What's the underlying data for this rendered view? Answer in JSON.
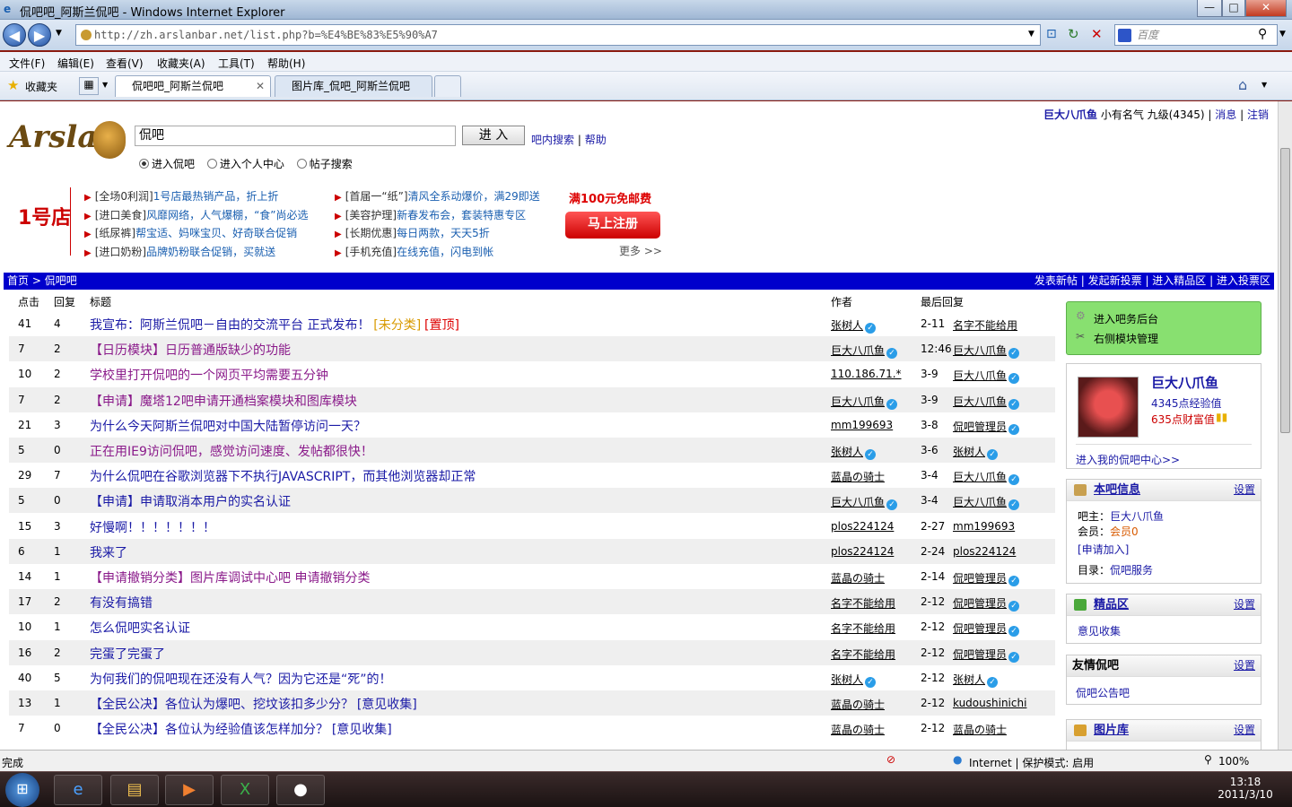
{
  "window": {
    "title": "侃吧吧_阿斯兰侃吧 - Windows Internet Explorer",
    "min": "—",
    "max": "□",
    "close": "✕"
  },
  "browser": {
    "url": "http://zh.arslanbar.net/list.php?b=%E4%BE%83%E5%90%A7",
    "search_placeholder": "百度",
    "menu": [
      "文件(F)",
      "编辑(E)",
      "查看(V)",
      "收藏夹(A)",
      "工具(T)",
      "帮助(H)"
    ],
    "favorites": "收藏夹",
    "tabs": [
      "侃吧吧_阿斯兰侃吧",
      "图片库_侃吧_阿斯兰侃吧"
    ]
  },
  "user": {
    "name": "巨大八爪鱼",
    "rank": "小有名气 九级(4345)",
    "msg": "消息",
    "logout": "注销",
    "sep": "|"
  },
  "site": {
    "logo": "Arslan"
  },
  "search": {
    "value": "侃吧",
    "button": "进 入",
    "inbar": "吧内搜索",
    "help": "帮助",
    "sep": "|",
    "options": [
      "进入侃吧",
      "进入个人中心",
      "帖子搜索"
    ]
  },
  "ad": {
    "brand": "1号店",
    "left": [
      [
        "[全场0利润]",
        "1号店最热销产品，折上折"
      ],
      [
        "[进口美食]",
        "风靡网络，人气爆棚，“食”尚必选"
      ],
      [
        "[纸尿裤]",
        "帮宝适、妈咪宝贝、好奇联合促销"
      ],
      [
        "[进口奶粉]",
        "品牌奶粉联合促销，买就送"
      ]
    ],
    "right": [
      [
        "[首届一“纸”]",
        "清风全系动爆价，满29即送"
      ],
      [
        "[美容护理]",
        "新春发布会，套装特惠专区"
      ],
      [
        "[长期优惠]",
        "每日两款，天天5折"
      ],
      [
        "[手机充值]",
        "在线充值，闪电到帐"
      ]
    ],
    "promo": "满100元免邮费",
    "register": "马上注册",
    "more": "更多 >>"
  },
  "nav": {
    "home": "首页",
    "sep": ">",
    "current": "侃吧吧",
    "links": [
      "发表新帖",
      "发起新投票",
      "进入精品区",
      "进入投票区"
    ]
  },
  "table": {
    "headers": [
      "点击",
      "回复",
      "标题",
      "作者",
      "最后回复"
    ],
    "rows": [
      {
        "c": "41",
        "r": "4",
        "t": "我宣布：阿斯兰侃吧－自由的交流平台 正式发布！",
        "tags": [
          "[未分类]",
          "[置顶]"
        ],
        "a": "张树人",
        "av": true,
        "d": "2-11",
        "l": "名字不能给用",
        "lv": false,
        "pk": false
      },
      {
        "c": "7",
        "r": "2",
        "t": "【日历模块】日历普通版缺少的功能",
        "tags": [],
        "a": "巨大八爪鱼",
        "av": true,
        "d": "12:46",
        "l": "巨大八爪鱼",
        "lv": true,
        "pk": true
      },
      {
        "c": "10",
        "r": "2",
        "t": "学校里打开侃吧的一个网页平均需要五分钟",
        "tags": [],
        "a": "110.186.71.*",
        "av": false,
        "d": "3-9",
        "l": "巨大八爪鱼",
        "lv": true,
        "pk": true
      },
      {
        "c": "7",
        "r": "2",
        "t": "【申请】魔塔12吧申请开通档案模块和图库模块",
        "tags": [],
        "a": "巨大八爪鱼",
        "av": true,
        "d": "3-9",
        "l": "巨大八爪鱼",
        "lv": true,
        "pk": true
      },
      {
        "c": "21",
        "r": "3",
        "t": "为什么今天阿斯兰侃吧对中国大陆暂停访问一天？",
        "tags": [],
        "a": "mm199693",
        "av": false,
        "d": "3-8",
        "l": "侃吧管理员",
        "lv": true,
        "pk": false
      },
      {
        "c": "5",
        "r": "0",
        "t": "正在用IE9访问侃吧，感觉访问速度、发帖都很快！",
        "tags": [],
        "a": "张树人",
        "av": true,
        "d": "3-6",
        "l": "张树人",
        "lv": true,
        "pk": true
      },
      {
        "c": "29",
        "r": "7",
        "t": "为什么侃吧在谷歌浏览器下不执行JAVASCRIPT，而其他浏览器却正常",
        "tags": [],
        "a": "蓝晶の骑士",
        "av": false,
        "d": "3-4",
        "l": "巨大八爪鱼",
        "lv": true,
        "pk": false
      },
      {
        "c": "5",
        "r": "0",
        "t": "【申请】申请取消本用户的实名认证",
        "tags": [],
        "a": "巨大八爪鱼",
        "av": true,
        "d": "3-4",
        "l": "巨大八爪鱼",
        "lv": true,
        "pk": false
      },
      {
        "c": "15",
        "r": "3",
        "t": "好慢啊！！！！！！！",
        "tags": [],
        "a": "plos224124",
        "av": false,
        "d": "2-27",
        "l": "mm199693",
        "lv": false,
        "pk": false
      },
      {
        "c": "6",
        "r": "1",
        "t": "我来了",
        "tags": [],
        "a": "plos224124",
        "av": false,
        "d": "2-24",
        "l": "plos224124",
        "lv": false,
        "pk": false
      },
      {
        "c": "14",
        "r": "1",
        "t": "【申请撤销分类】图片库调试中心吧 申请撤销分类",
        "tags": [],
        "a": "蓝晶の骑士",
        "av": false,
        "d": "2-14",
        "l": "侃吧管理员",
        "lv": true,
        "pk": true
      },
      {
        "c": "17",
        "r": "2",
        "t": "有没有搞错",
        "tags": [],
        "a": "名字不能给用",
        "av": false,
        "d": "2-12",
        "l": "侃吧管理员",
        "lv": true,
        "pk": false
      },
      {
        "c": "10",
        "r": "1",
        "t": "怎么侃吧实名认证",
        "tags": [],
        "a": "名字不能给用",
        "av": false,
        "d": "2-12",
        "l": "侃吧管理员",
        "lv": true,
        "pk": false
      },
      {
        "c": "16",
        "r": "2",
        "t": "完蛋了完蛋了",
        "tags": [],
        "a": "名字不能给用",
        "av": false,
        "d": "2-12",
        "l": "侃吧管理员",
        "lv": true,
        "pk": false
      },
      {
        "c": "40",
        "r": "5",
        "t": "为何我们的侃吧现在还没有人气？因为它还是“死”的！",
        "tags": [],
        "a": "张树人",
        "av": true,
        "d": "2-12",
        "l": "张树人",
        "lv": true,
        "pk": false
      },
      {
        "c": "13",
        "r": "1",
        "t": "【全民公决】各位认为爆吧、挖坟该扣多少分？",
        "tags": [
          "[意见收集]"
        ],
        "a": "蓝晶の骑士",
        "av": false,
        "d": "2-12",
        "l": "kudoushinichi",
        "lv": false,
        "pk": false
      },
      {
        "c": "7",
        "r": "0",
        "t": "【全民公决】各位认为经验值该怎样加分？",
        "tags": [
          "[意见收集]"
        ],
        "a": "蓝晶の骑士",
        "av": false,
        "d": "2-12",
        "l": "蓝晶の骑士",
        "lv": false,
        "pk": false
      }
    ]
  },
  "side": {
    "admin": "进入吧务后台",
    "module": "右侧模块管理",
    "profile": {
      "name": "巨大八爪鱼",
      "exp": "4345点经验值",
      "wealth": "635点财富值",
      "center": "进入我的侃吧中心>>"
    },
    "info": {
      "title": "本吧信息",
      "set": "设置",
      "owner_label": "吧主：",
      "owner": "巨大八爪鱼",
      "member_label": "会员：",
      "members": "会员0",
      "join": "[申请加入]",
      "dir_label": "目录：",
      "dir": "侃吧服务"
    },
    "best": {
      "title": "精品区",
      "set": "设置",
      "item": "意见收集"
    },
    "friends": {
      "title": "友情侃吧",
      "set": "设置",
      "item": "侃吧公告吧"
    },
    "pics": {
      "title": "图片库",
      "set": "设置"
    }
  },
  "status": {
    "done": "完成",
    "zone": "Internet | 保护模式: 启用",
    "zoom": "100%"
  },
  "clock": {
    "time": "13:18",
    "date": "2011/3/10"
  }
}
